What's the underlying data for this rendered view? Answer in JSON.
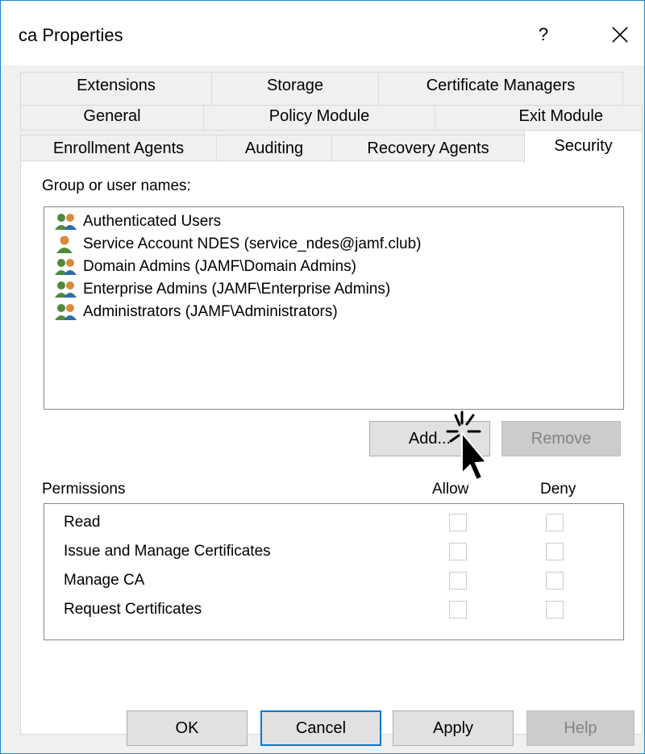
{
  "window": {
    "title": "ca Properties",
    "help_label": "?",
    "close_icon": "close-icon"
  },
  "tabs": {
    "row1": [
      "Extensions",
      "Storage",
      "Certificate Managers"
    ],
    "row2": [
      "General",
      "Policy Module",
      "Exit Module"
    ],
    "row3": [
      "Enrollment Agents",
      "Auditing",
      "Recovery Agents",
      "Security"
    ],
    "active": "Security"
  },
  "security": {
    "group_label": "Group or user names:",
    "users": [
      {
        "name": "Authenticated Users",
        "icon": "user-group-icon"
      },
      {
        "name": "Service Account NDES (service_ndes@jamf.club)",
        "icon": "user-icon"
      },
      {
        "name": "Domain Admins (JAMF\\Domain Admins)",
        "icon": "user-group-icon"
      },
      {
        "name": "Enterprise Admins (JAMF\\Enterprise Admins)",
        "icon": "user-group-icon"
      },
      {
        "name": "Administrators (JAMF\\Administrators)",
        "icon": "user-group-icon"
      }
    ],
    "add_label": "Add...",
    "remove_label": "Remove",
    "permissions_label": "Permissions",
    "allow_label": "Allow",
    "deny_label": "Deny",
    "permissions": [
      {
        "name": "Read",
        "allow": false,
        "deny": false
      },
      {
        "name": "Issue and Manage Certificates",
        "allow": false,
        "deny": false
      },
      {
        "name": "Manage CA",
        "allow": false,
        "deny": false
      },
      {
        "name": "Request Certificates",
        "allow": false,
        "deny": false
      }
    ]
  },
  "footer": {
    "ok_label": "OK",
    "cancel_label": "Cancel",
    "apply_label": "Apply",
    "help_label": "Help"
  },
  "colors": {
    "accent": "#0078d7",
    "group_icon_green": "#4f8a3c",
    "group_icon_orange": "#d98a3a",
    "user_icon_blue": "#2e6da4"
  }
}
